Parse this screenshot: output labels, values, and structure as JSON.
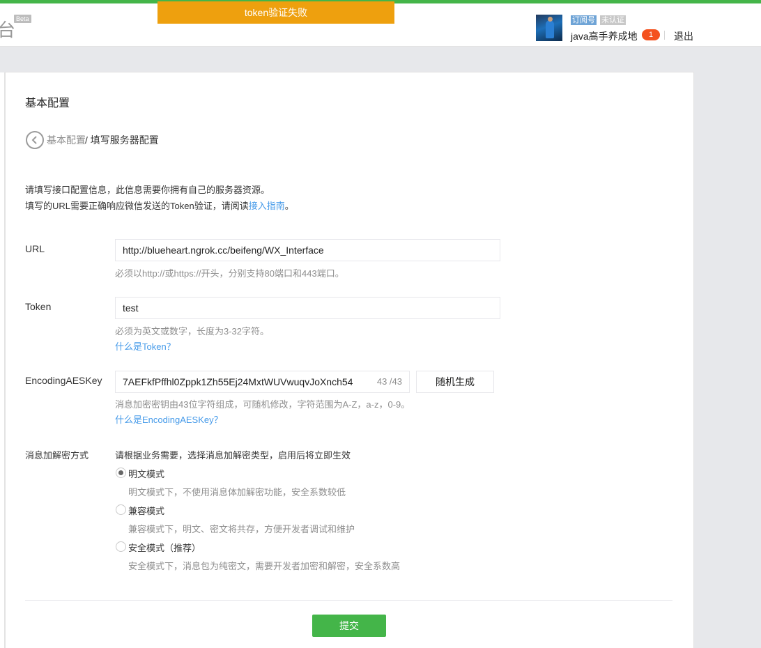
{
  "header": {
    "logo_char": "台",
    "beta": "Beta",
    "toast": "token验证失败",
    "tag_subscription": "订阅号",
    "tag_unverified": "未认证",
    "account_name": "java高手养成地",
    "notice_count": "1",
    "logout": "退出"
  },
  "page": {
    "title": "基本配置",
    "breadcrumb_parent": "基本配置",
    "breadcrumb_current": "/ 填写服务器配置",
    "intro_line1": "请填写接口配置信息，此信息需要你拥有自己的服务器资源。",
    "intro_line2_prefix": "填写的URL需要正确响应微信发送的Token验证，请阅读",
    "intro_line2_link": "接入指南",
    "intro_line2_suffix": "。"
  },
  "form": {
    "url": {
      "label": "URL",
      "value": "http://blueheart.ngrok.cc/beifeng/WX_Interface",
      "hint": "必须以http://或https://开头，分别支持80端口和443端口。"
    },
    "token": {
      "label": "Token",
      "value": "test",
      "hint": "必须为英文或数字，长度为3-32字符。",
      "help": "什么是Token？"
    },
    "aes": {
      "label": "EncodingAESKey",
      "value": "7AEFkfPffhl0Zppk1Zh55Ej24MxtWUVwuqvJoXnch54",
      "counter": "43 /43",
      "generate": "随机生成",
      "hint": "消息加密密钥由43位字符组成，可随机修改，字符范围为A-Z，a-z，0-9。",
      "help": "什么是EncodingAESKey？"
    },
    "mode": {
      "label": "消息加解密方式",
      "intro": "请根据业务需要，选择消息加解密类型，启用后将立即生效",
      "options": [
        {
          "label": "明文模式",
          "desc": "明文模式下，不使用消息体加解密功能，安全系数较低",
          "checked": true
        },
        {
          "label": "兼容模式",
          "desc": "兼容模式下，明文、密文将共存，方便开发者调试和维护",
          "checked": false
        },
        {
          "label": "安全模式（推荐）",
          "desc": "安全模式下，消息包为纯密文，需要开发者加密和解密，安全系数高",
          "checked": false
        }
      ]
    },
    "submit": "提交"
  },
  "colors": {
    "brand_green": "#44b549",
    "toast_orange": "#eea00e",
    "link_blue": "#459ae9",
    "badge_red": "#f4511e"
  }
}
